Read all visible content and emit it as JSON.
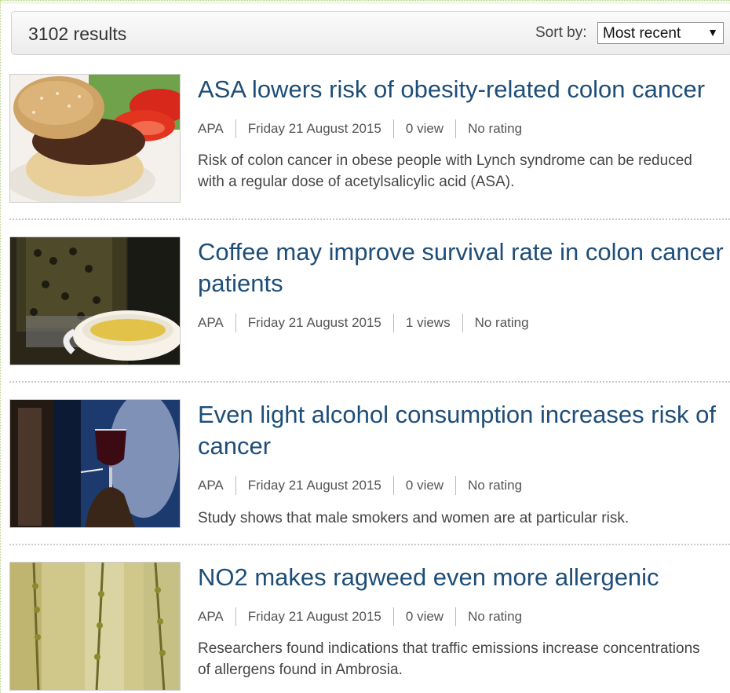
{
  "results": {
    "count_text": "3102 results",
    "sort_label": "Sort by:",
    "sort_value": "Most recent"
  },
  "articles": [
    {
      "title": "ASA lowers risk of obesity-related colon cancer",
      "source": "APA",
      "date": "Friday 21 August 2015",
      "views": "0 view",
      "rating": "No rating",
      "summary": "Risk of colon cancer in obese people with Lynch syndrome can be reduced with a regular dose of acetylsalicylic acid (ASA).",
      "image": "burger-photo"
    },
    {
      "title": "Coffee may improve survival rate in colon cancer patients",
      "source": "APA",
      "date": "Friday 21 August 2015",
      "views": "1 views",
      "rating": "No rating",
      "summary": "",
      "image": "coffee-photo"
    },
    {
      "title": "Even light alcohol consumption increases risk of cancer",
      "source": "APA",
      "date": "Friday 21 August 2015",
      "views": "0 view",
      "rating": "No rating",
      "summary": "Study shows that male smokers and women are at particular risk.",
      "image": "wine-glass-photo"
    },
    {
      "title": "NO2 makes ragweed even more allergenic",
      "source": "APA",
      "date": "Friday 21 August 2015",
      "views": "0 view",
      "rating": "No rating",
      "summary": "Researchers found indications that traffic emissions increase concentrations of allergens found in Ambrosia.",
      "image": "ragweed-photo"
    }
  ],
  "colors": {
    "title": "#1e4e78",
    "frame": "#b9d48a"
  }
}
